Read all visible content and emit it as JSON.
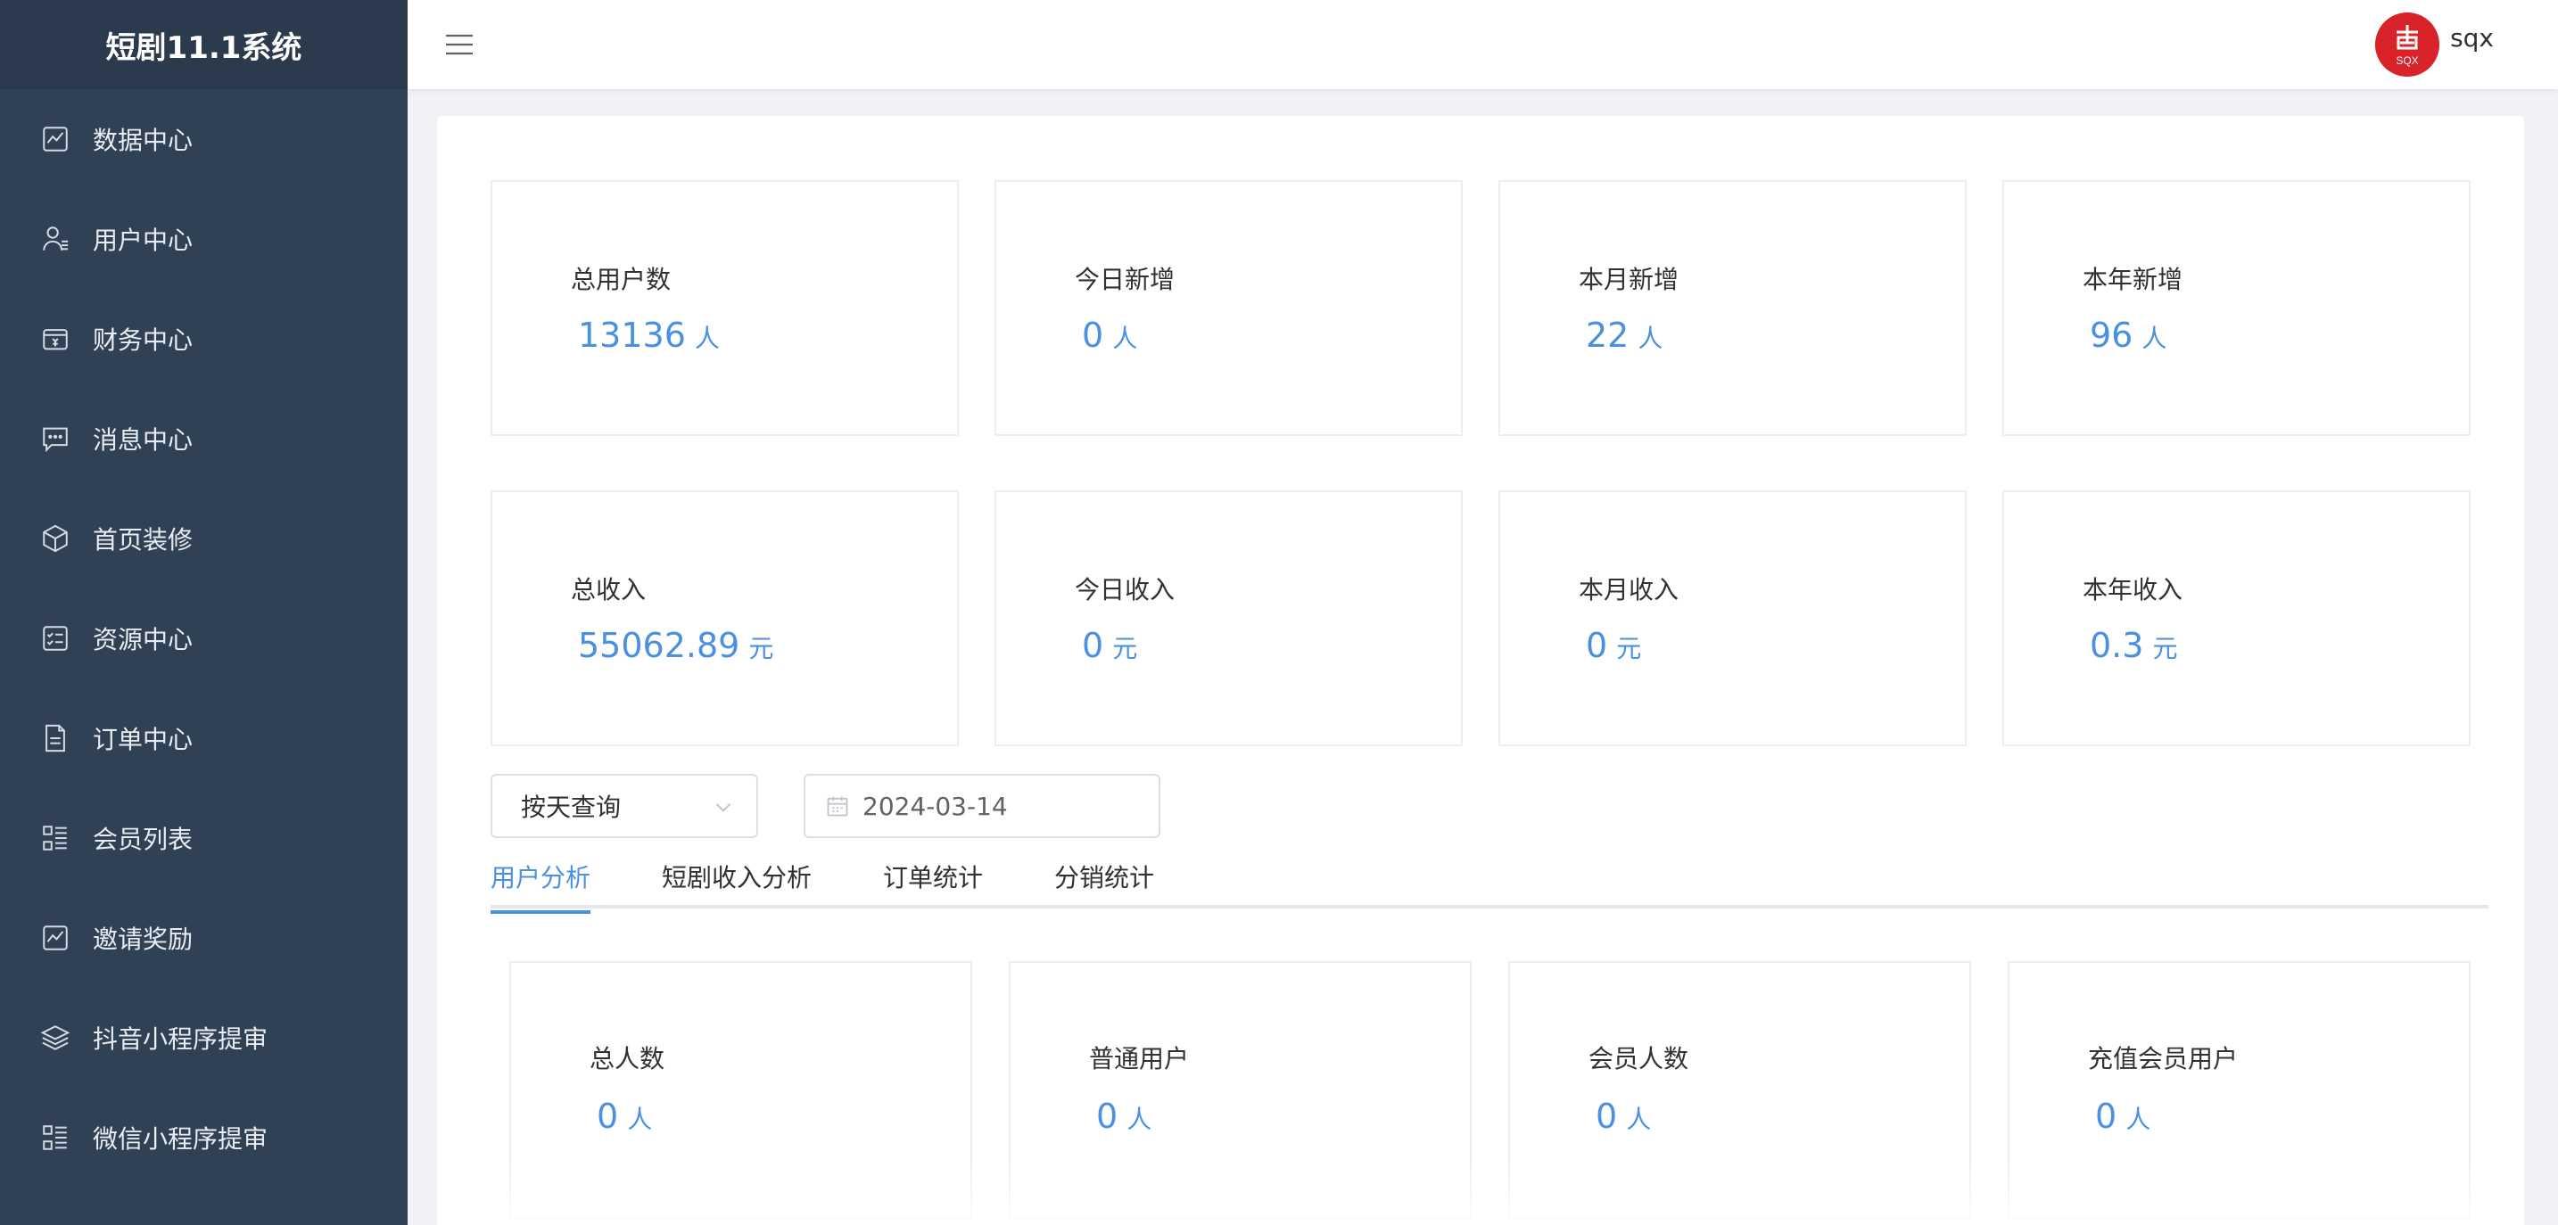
{
  "app": {
    "title": "短剧11.1系统"
  },
  "sidebar": {
    "items": [
      {
        "label": "数据中心",
        "icon": "chart-icon"
      },
      {
        "label": "用户中心",
        "icon": "user-icon"
      },
      {
        "label": "财务中心",
        "icon": "finance-icon"
      },
      {
        "label": "消息中心",
        "icon": "message-icon"
      },
      {
        "label": "首页装修",
        "icon": "box-icon"
      },
      {
        "label": "资源中心",
        "icon": "checklist-icon"
      },
      {
        "label": "订单中心",
        "icon": "document-icon"
      },
      {
        "label": "会员列表",
        "icon": "list-icon"
      },
      {
        "label": "邀请奖励",
        "icon": "chart-icon"
      },
      {
        "label": "抖音小程序提审",
        "icon": "layers-icon"
      },
      {
        "label": "微信小程序提审",
        "icon": "list-icon"
      }
    ]
  },
  "header": {
    "username": "sqx",
    "avatar_color": "#d8232a",
    "avatar_text": "SQX"
  },
  "stats_users": [
    {
      "label": "总用户数",
      "value": "13136",
      "unit": "人"
    },
    {
      "label": "今日新增",
      "value": "0",
      "unit": "人"
    },
    {
      "label": "本月新增",
      "value": "22",
      "unit": "人"
    },
    {
      "label": "本年新增",
      "value": "96",
      "unit": "人"
    }
  ],
  "stats_income": [
    {
      "label": "总收入",
      "value": "55062.89",
      "unit": "元"
    },
    {
      "label": "今日收入",
      "value": "0",
      "unit": "元"
    },
    {
      "label": "本月收入",
      "value": "0",
      "unit": "元"
    },
    {
      "label": "本年收入",
      "value": "0.3",
      "unit": "元"
    }
  ],
  "filters": {
    "query_mode": "按天查询",
    "date": "2024-03-14"
  },
  "tabs": [
    {
      "label": "用户分析",
      "active": true
    },
    {
      "label": "短剧收入分析",
      "active": false
    },
    {
      "label": "订单统计",
      "active": false
    },
    {
      "label": "分销统计",
      "active": false
    }
  ],
  "user_analysis": [
    {
      "label": "总人数",
      "value": "0",
      "unit": "人"
    },
    {
      "label": "普通用户",
      "value": "0",
      "unit": "人"
    },
    {
      "label": "会员人数",
      "value": "0",
      "unit": "人"
    },
    {
      "label": "充值会员用户",
      "value": "0",
      "unit": "人"
    }
  ],
  "colors": {
    "sidebar_bg": "#304156",
    "accent": "#4a90e2"
  }
}
